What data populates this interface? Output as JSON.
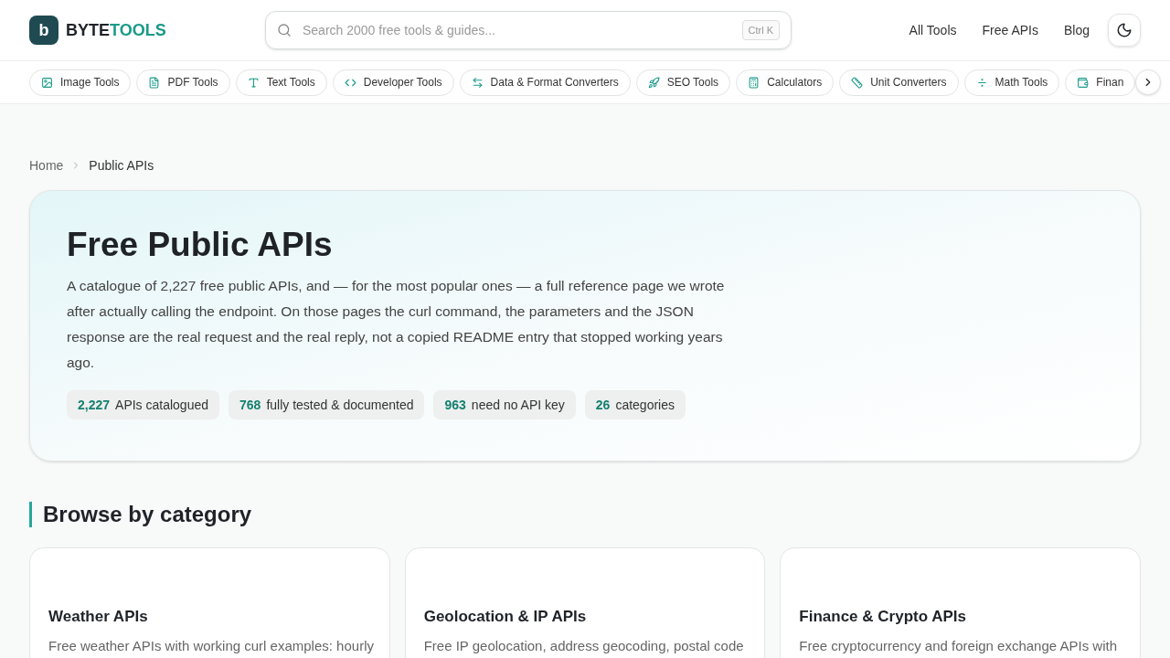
{
  "header": {
    "logo_mark": "b",
    "brand_primary": "BYTE",
    "brand_accent": "TOOLS",
    "search": {
      "placeholder": "Search 2000 free tools & guides...",
      "shortcut": "Ctrl K"
    },
    "nav": [
      "All Tools",
      "Free APIs",
      "Blog"
    ]
  },
  "categories": [
    {
      "label": "Image Tools"
    },
    {
      "label": "PDF Tools"
    },
    {
      "label": "Text Tools"
    },
    {
      "label": "Developer Tools"
    },
    {
      "label": "Data & Format Converters"
    },
    {
      "label": "SEO Tools"
    },
    {
      "label": "Calculators"
    },
    {
      "label": "Unit Converters"
    },
    {
      "label": "Math Tools"
    },
    {
      "label": "Finan"
    }
  ],
  "breadcrumb": [
    "Home",
    "Public APIs"
  ],
  "hero": {
    "title": "Free Public APIs",
    "description": "A catalogue of 2,227 free public APIs, and — for the most popular ones — a full reference page we wrote after actually calling the endpoint. On those pages the curl command, the parameters and the JSON response are the real request and the real reply, not a copied README entry that stopped working years ago.",
    "stats": [
      {
        "value": "2,227",
        "label": "APIs catalogued"
      },
      {
        "value": "768",
        "label": "fully tested & documented"
      },
      {
        "value": "963",
        "label": "need no API key"
      },
      {
        "value": "26",
        "label": "categories"
      }
    ]
  },
  "section_title": "Browse by category",
  "cards": [
    {
      "title": "Weather APIs",
      "description": "Free weather APIs with working curl examples: hourly"
    },
    {
      "title": "Geolocation & IP APIs",
      "description": "Free IP geolocation, address geocoding, postal code"
    },
    {
      "title": "Finance & Crypto APIs",
      "description": "Free cryptocurrency and foreign exchange APIs with"
    }
  ]
}
